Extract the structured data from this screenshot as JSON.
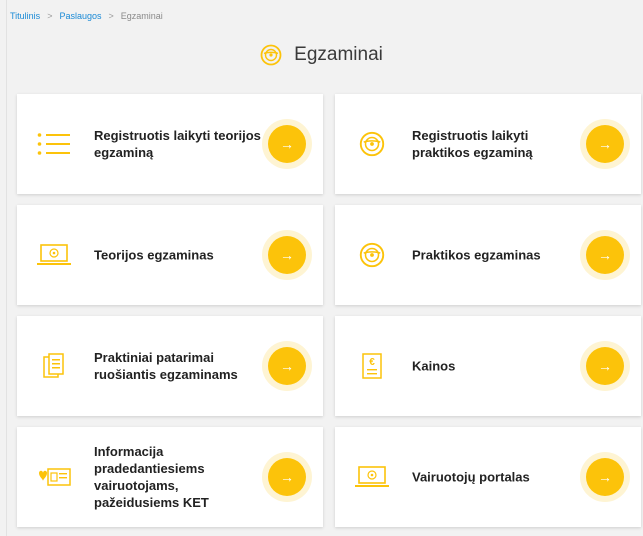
{
  "breadcrumb": {
    "home": "Titulinis",
    "sep": ">",
    "services": "Paslaugos",
    "current": "Egzaminai"
  },
  "page": {
    "title": "Egzaminai",
    "title_icon": "steering-wheel-icon"
  },
  "colors": {
    "accent": "#fcc30a",
    "link": "#1a8ad6",
    "background": "#f2f2f2"
  },
  "cards": [
    {
      "label": "Registruotis laikyti teorijos egzaminą",
      "icon": "list-icon",
      "arrow": "→"
    },
    {
      "label": "Registruotis laikyti praktikos egzaminą",
      "icon": "steering-wheel-icon",
      "arrow": "→"
    },
    {
      "label": "Teorijos egzaminas",
      "icon": "laptop-icon",
      "arrow": "→"
    },
    {
      "label": "Praktikos egzaminas",
      "icon": "steering-wheel-icon",
      "arrow": "→"
    },
    {
      "label": "Praktiniai patarimai ruošiantis egzaminams",
      "icon": "document-icon",
      "arrow": "→"
    },
    {
      "label": "Kainos",
      "icon": "euro-document-icon",
      "arrow": "→"
    },
    {
      "label": "Informacija pradedantiesiems vairuotojams, pažeidusiems KET",
      "icon": "license-card-icon",
      "arrow": "→"
    },
    {
      "label": "Vairuotojų portalas",
      "icon": "laptop-icon",
      "arrow": "→"
    }
  ]
}
